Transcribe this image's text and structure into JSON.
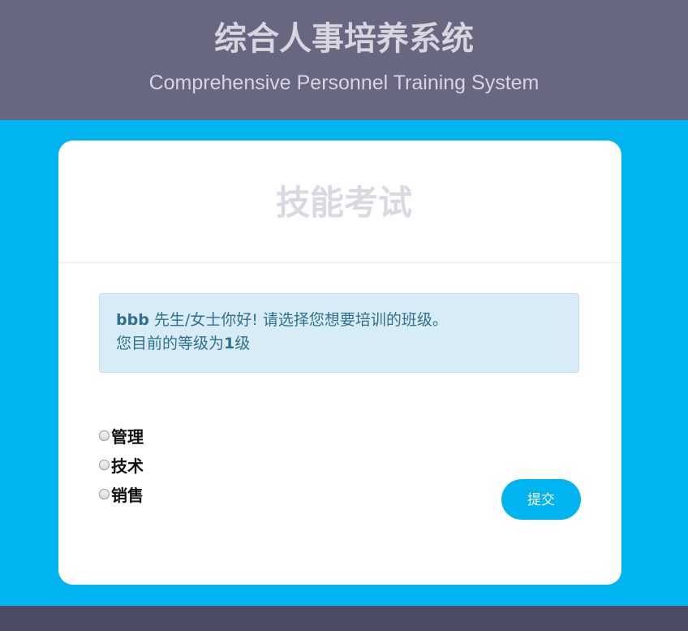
{
  "header": {
    "title": "综合人事培养系统",
    "subtitle": "Comprehensive Personnel Training System"
  },
  "card": {
    "title": "技能考试"
  },
  "alert": {
    "username": "bbb",
    "greeting_text": " 先生/女士你好! 请选择您想要培训的班级。",
    "level_prefix": "您目前的等级为",
    "level_value": "1",
    "level_suffix": "级"
  },
  "options": [
    {
      "label": "管理"
    },
    {
      "label": "技术"
    },
    {
      "label": "销售"
    }
  ],
  "submit_label": "提交",
  "colors": {
    "header_bg": "#676781",
    "page_bg": "#00b4f0",
    "card_bg": "#ffffff",
    "alert_bg": "#d8ecf6",
    "alert_text": "#30708f",
    "button_bg": "#00b4f0",
    "footer_bg": "#4b4b63"
  }
}
